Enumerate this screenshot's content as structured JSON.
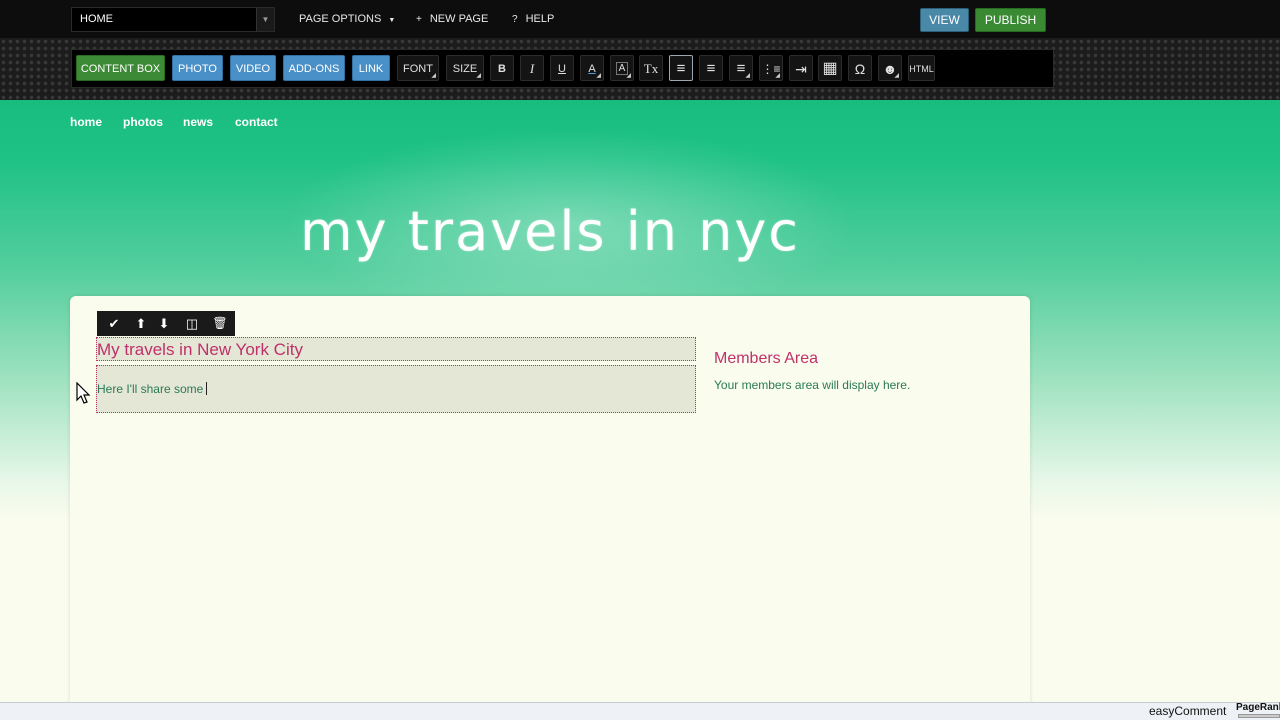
{
  "topbar": {
    "page_select": "HOME",
    "page_options": "PAGE OPTIONS",
    "new_page": "NEW PAGE",
    "help": "HELP",
    "view": "VIEW",
    "publish": "PUBLISH",
    "new_page_icon": "+",
    "help_icon": "?",
    "dropdown_icon": "▼"
  },
  "toolbar": {
    "content_box": "CONTENT BOX",
    "photo": "PHOTO",
    "video": "VIDEO",
    "addons": "ADD-ONS",
    "link": "LINK",
    "font": "FONT",
    "size": "SIZE",
    "bold": "B",
    "italic": "I",
    "underline": "U",
    "text_color": "A",
    "bg_color": "A",
    "clear_format": "Tx",
    "align_left": "≡",
    "align_center": "≡",
    "align_right": "≡",
    "bullets": "⋮≡",
    "indent": "⇥",
    "table": "▦",
    "special_char": "Ω",
    "emoticon": "☻",
    "html": "HTML"
  },
  "nav": [
    "home",
    "photos",
    "news",
    "contact"
  ],
  "site_title": "my travels in nyc",
  "element_toolbar": {
    "check": "✔",
    "up": "⬆",
    "down": "⬇",
    "columns": "◫",
    "trash": "🗑"
  },
  "content": {
    "title": "My travels in New York City",
    "paragraph": "Here I'll share some"
  },
  "sidebar": {
    "members_title": "Members Area",
    "members_text": "Your members area will display here."
  },
  "status": {
    "easy_comment": "easyComment",
    "pagerank": "PageRank"
  },
  "colors": {
    "banner_green": "#18bd7e",
    "heading_pink": "#c0306a",
    "body_green": "#2a7a55",
    "view_blue": "#4a88a8",
    "publish_green": "#3a8a34"
  }
}
